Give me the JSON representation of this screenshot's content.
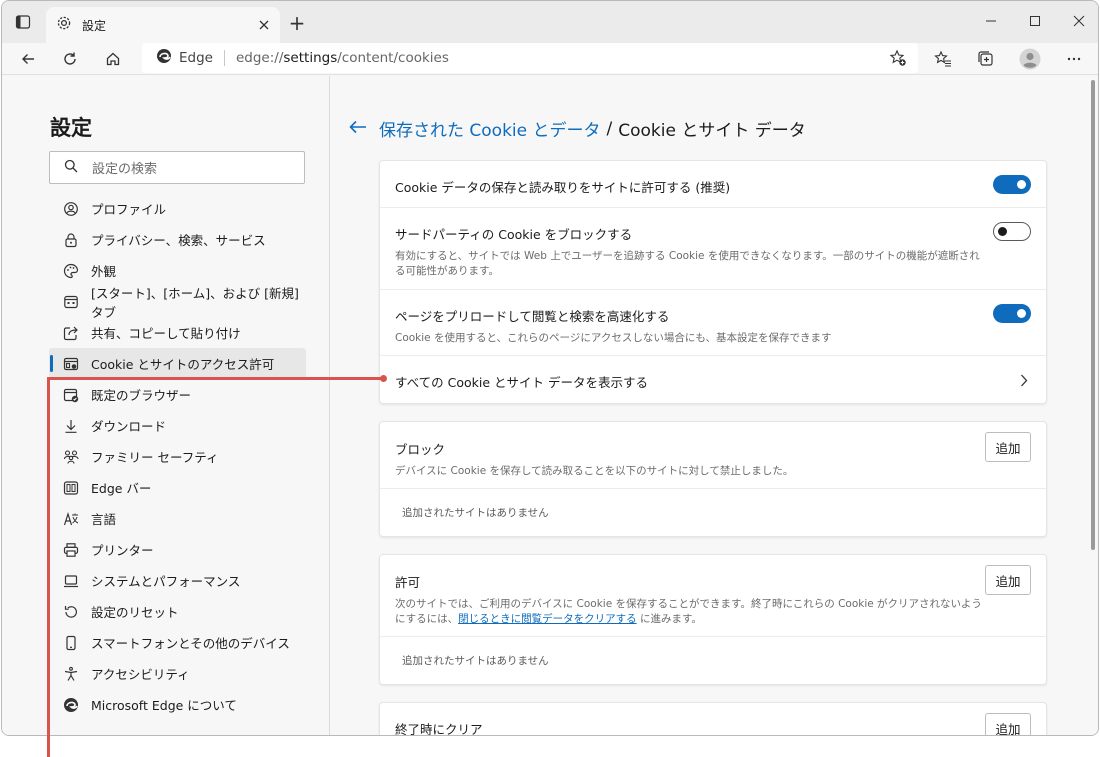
{
  "browser": {
    "tab_title": "設定",
    "new_tab_symbol": "+",
    "omnibox": {
      "brand": "Edge",
      "url_scheme": "edge://",
      "url_path": "settings",
      "url_rest": "/content/cookies"
    }
  },
  "sidebar": {
    "title": "設定",
    "search_placeholder": "設定の検索",
    "items": [
      {
        "label": "プロファイル",
        "icon": "profile-icon"
      },
      {
        "label": "プライバシー、検索、サービス",
        "icon": "lock-icon"
      },
      {
        "label": "外観",
        "icon": "palette-icon"
      },
      {
        "label": "[スタート]、[ホーム]、および [新規] タブ",
        "icon": "home-tabs-icon"
      },
      {
        "label": "共有、コピーして貼り付け",
        "icon": "share-icon"
      },
      {
        "label": "Cookie とサイトのアクセス許可",
        "icon": "site-permissions-icon",
        "active": true
      },
      {
        "label": "既定のブラウザー",
        "icon": "default-browser-icon"
      },
      {
        "label": "ダウンロード",
        "icon": "download-icon"
      },
      {
        "label": "ファミリー セーフティ",
        "icon": "family-icon"
      },
      {
        "label": "Edge バー",
        "icon": "edge-bar-icon"
      },
      {
        "label": "言語",
        "icon": "language-icon"
      },
      {
        "label": "プリンター",
        "icon": "printer-icon"
      },
      {
        "label": "システムとパフォーマンス",
        "icon": "laptop-icon"
      },
      {
        "label": "設定のリセット",
        "icon": "reset-icon"
      },
      {
        "label": "スマートフォンとその他のデバイス",
        "icon": "phone-icon"
      },
      {
        "label": "アクセシビリティ",
        "icon": "accessibility-icon"
      },
      {
        "label": "Microsoft Edge について",
        "icon": "edge-logo-icon"
      }
    ]
  },
  "main": {
    "breadcrumb_link": "保存された Cookie とデータ",
    "breadcrumb_sep": "/",
    "breadcrumb_current": "Cookie とサイト データ",
    "settings": {
      "allow_cookies": {
        "title": "Cookie データの保存と読み取りをサイトに許可する (推奨)",
        "enabled": true
      },
      "block_third_party": {
        "title": "サードパーティの Cookie をブロックする",
        "desc": "有効にすると、サイトでは Web 上でユーザーを追跡する Cookie を使用できなくなります。一部のサイトの機能が遮断される可能性があります。",
        "enabled": false
      },
      "preload": {
        "title": "ページをプリロードして閲覧と検索を高速化する",
        "desc": "Cookie を使用すると、これらのページにアクセスしない場合にも、基本設定を保存できます",
        "enabled": true
      },
      "see_all": {
        "title": "すべての Cookie とサイト データを表示する"
      }
    },
    "block": {
      "title": "ブロック",
      "desc": "デバイスに Cookie を保存して読み取ることを以下のサイトに対して禁止しました。",
      "add_label": "追加",
      "empty": "追加されたサイトはありません"
    },
    "allow": {
      "title": "許可",
      "desc_1": "次のサイトでは、ご利用のデバイスに Cookie を保存することができます。終了時にこれらの Cookie がクリアされないようにするには、",
      "desc_link": "閉じるときに閲覧データをクリアする",
      "desc_2": " に進みます。",
      "add_label": "追加",
      "empty": "追加されたサイトはありません"
    },
    "clear_on_exit": {
      "title": "終了時にクリア",
      "add_label": "追加"
    }
  },
  "colors": {
    "accent": "#0f6cbd",
    "callout": "#d9534f"
  }
}
